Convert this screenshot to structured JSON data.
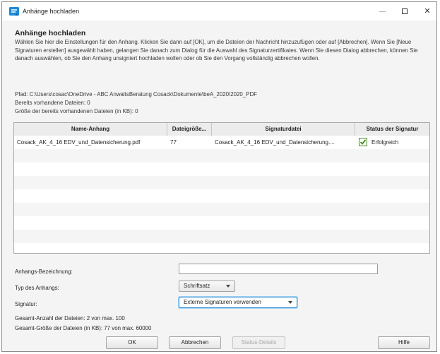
{
  "window": {
    "title": "Anhänge hochladen",
    "app_icon": "app-logo-icon",
    "controls": [
      "minimize-icon",
      "maximize-icon",
      "close-icon"
    ],
    "close_glyph": "✕"
  },
  "dialog": {
    "heading": "Anhänge hochladen",
    "description": "Wählen Sie hier die Einstellungen für den Anhang. Klicken Sie dann auf [OK], um die Dateien der Nachricht hinzuzufügen oder auf [Abbrechen]. Wenn Sie [Neue Signaturen erstellen] ausgewählt haben, gelangen Sie danach zum Dialog für die Auswahl des Signaturzertifikates. Wenn Sie diesen Dialog abbrechen, können Sie danach auswählen, ob Sie den Anhang unsigniert hochladen wollen oder ob Sie den Vorgang vollständig abbrechen wollen.",
    "path": "Pfad: C:\\Users\\cosac\\OneDrive - ABC AnwaltsBeratung Cosack\\Dokumente\\beA_2020\\2020_PDF",
    "existing_files": "Bereits vorhandene Dateien: 0",
    "existing_size": "Größe der bereits vorhandenen Dateien (in KB): 0"
  },
  "table": {
    "columns": [
      "Name-Anhang",
      "Dateigröße...",
      "Signaturdatei",
      "Status der Signatur"
    ],
    "rows": [
      {
        "name": "Cosack_AK_4_16 EDV_und_Datensicherung.pdf",
        "size": "77",
        "signature_file": "Cosack_AK_4_16 EDV_und_Datensicherung....",
        "status": "Erfolgreich",
        "status_icon": "checkmark-icon"
      }
    ]
  },
  "form": {
    "designation_label": "Anhangs-Bezeichnung:",
    "designation_value": "",
    "type_label": "Typ des Anhangs:",
    "type_value": "Schriftsatz",
    "signature_label": "Signatur:",
    "signature_value": "Externe Signaturen verwenden",
    "total_count": "Gesamt-Anzahl der Dateien: 2 von max. 100",
    "total_size": "Gesamt-Größe der Dateien (in KB): 77 von max. 60000"
  },
  "buttons": {
    "ok": "OK",
    "cancel": "Abbrechen",
    "status_details": "Status-Details",
    "help": "Hilfe"
  },
  "colors": {
    "accent": "#2f8fd8",
    "check_green": "#3f8f1f"
  }
}
